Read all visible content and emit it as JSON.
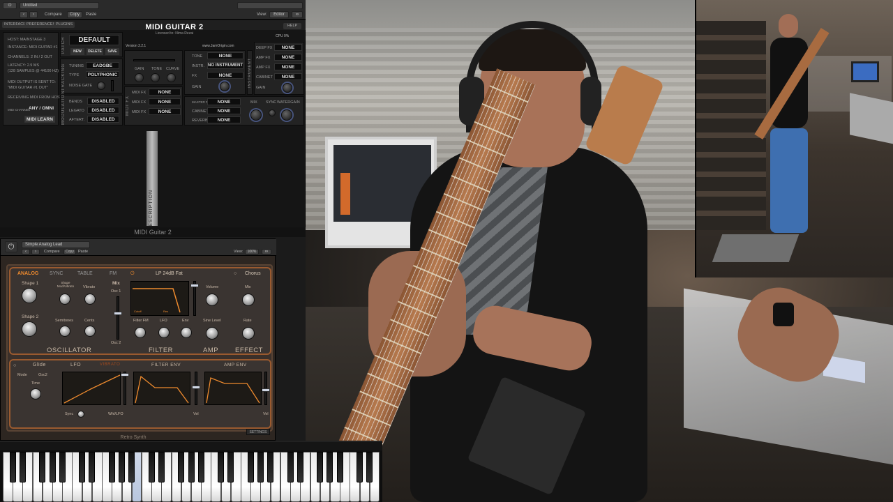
{
  "midi_guitar": {
    "host_bar": {
      "preset_name": "Untitled",
      "compare": "Compare",
      "copy": "Copy",
      "paste": "Paste",
      "view_label": "View:",
      "view_value": "Editor"
    },
    "tabs": [
      "INTERFACE",
      "PREFERENCES",
      "PLUGINS"
    ],
    "title": "MIDI GUITAR 2",
    "subtitle": "Licensed to: Nima Rezai",
    "help": "HELP",
    "cpu": "CPU 0%",
    "version": "Version 2.2.1",
    "website": "www.JamOrigin.com",
    "info": {
      "host": "HOST: MAINSTAGE 3",
      "instance": "INSTANCE: MIDI GUITAR #1",
      "channels": "CHANNELS: 2 IN / 2 OUT",
      "latency": "LATENCY: 2.9 MS",
      "samples": "(128 SAMPLES @ 44100 HZ)",
      "midi_output": "MIDI OUTPUT IS SENT TO:",
      "midi_target": "\"MIDI GUITAR #1 OUT\"",
      "receiving": "RECEIVING MIDI FROM HOST",
      "channel_label": "MIDI CHANNEL",
      "channel_value": "ANY / OMNI",
      "midi_learn": "MIDI LEARN"
    },
    "patch": {
      "label": "PATCH",
      "name": "DEFAULT",
      "new": "NEW",
      "delete": "DELETE",
      "save": "SAVE"
    },
    "tracking": {
      "label": "TRACKING",
      "tuning_label": "TUNING",
      "tuning_value": "EADGBE",
      "type_label": "TYPE",
      "type_value": "POLYPHONIC",
      "noise_gate": "NOISE GATE"
    },
    "modulation": {
      "label": "MODULATION",
      "rows": [
        {
          "label": "BENDS",
          "value": "DISABLED"
        },
        {
          "label": "LEGATO",
          "value": "DISABLED"
        },
        {
          "label": "AFTERT.",
          "value": "DISABLED"
        }
      ]
    },
    "mixer": {
      "knobs": [
        "GAIN",
        "TONE",
        "CURVE"
      ]
    },
    "midi_fx": {
      "label": "MIDI FX",
      "rows": [
        {
          "label": "MIDI FX",
          "value": "NONE"
        },
        {
          "label": "MIDI FX",
          "value": "NONE"
        },
        {
          "label": "MIDI FX",
          "value": "NONE"
        }
      ]
    },
    "instrument": {
      "label": "INSTRUMENT",
      "rows": [
        {
          "label": "TONE",
          "value": "NONE"
        },
        {
          "label": "INSTR.",
          "value": "NO INSTRUMENT"
        },
        {
          "label": "FX",
          "value": "NONE"
        }
      ],
      "gain": "GAIN"
    },
    "guitar_fx": {
      "label": "GUITAR",
      "rows": [
        {
          "label": "DEEP FX",
          "value": "NONE"
        },
        {
          "label": "AMP FX",
          "value": "NONE"
        },
        {
          "label": "AMP FX",
          "value": "NONE"
        },
        {
          "label": "CABINET",
          "value": "NONE"
        }
      ],
      "gain": "GAIN"
    },
    "master": {
      "label": "MASTER",
      "rows": [
        {
          "label": "MASTER FX",
          "value": "NONE"
        },
        {
          "label": "CABINET",
          "value": "NONE"
        },
        {
          "label": "REVERB",
          "value": "NONE"
        }
      ],
      "mix": "MIX",
      "sync": "SYNC",
      "watergain": "WATERGAIN"
    },
    "description_tab": "DESCRIPTION",
    "footer": "MIDI Guitar 2"
  },
  "retro_synth": {
    "host_bar": {
      "preset_name": "Simple Analog Lead",
      "compare": "Compare",
      "copy": "Copy",
      "paste": "Paste",
      "view_label": "View:",
      "view_value": "100%"
    },
    "tabs": [
      {
        "label": "ANALOG",
        "active": true
      },
      {
        "label": "SYNC",
        "active": false
      },
      {
        "label": "TABLE",
        "active": false
      },
      {
        "label": "FM",
        "active": false
      }
    ],
    "filter_type": "LP 24dB Fat",
    "chorus": "Chorus",
    "oscillator": {
      "title": "OSCILLATOR",
      "shape1": "Shape 1",
      "shape2": "Shape 2",
      "labels": [
        "Shape Mod/Vibrato",
        "Vibrato",
        "Semitones",
        "Cents"
      ],
      "mix": "Mix",
      "osc1": "Osc 1",
      "osc2": "Osc 2"
    },
    "filter": {
      "title": "FILTER",
      "knobs": [
        "Filter FM",
        "LFO",
        "Env"
      ],
      "readout_a": "Cutoff",
      "readout_b": "Res"
    },
    "amp": {
      "title": "AMP",
      "knobs": [
        "Volume",
        "Sine Level"
      ]
    },
    "effect": {
      "title": "EFFECT",
      "knobs": [
        "Mix",
        "Rate"
      ]
    },
    "bottom": {
      "glide": "Glide",
      "glide_mode": "Mode",
      "glide_mode_value": "Osc2",
      "glide_time": "Time",
      "lfo": "LFO",
      "vibrato": "VIBRATO",
      "filter_env": "FILTER ENV",
      "amp_env": "AMP ENV",
      "sync": "Sync",
      "wheel": "Whl/LFO",
      "vel": "Vel"
    },
    "settings": "SETTINGS",
    "footer": "Retro Synth"
  },
  "keyboard": {
    "white_keys": 38,
    "pressed_white_keys": [
      13
    ]
  },
  "colors": {
    "accent_orange": "#ef8b2e",
    "synth_frame": "#9a5a2f",
    "mg_panel": "#232323"
  }
}
